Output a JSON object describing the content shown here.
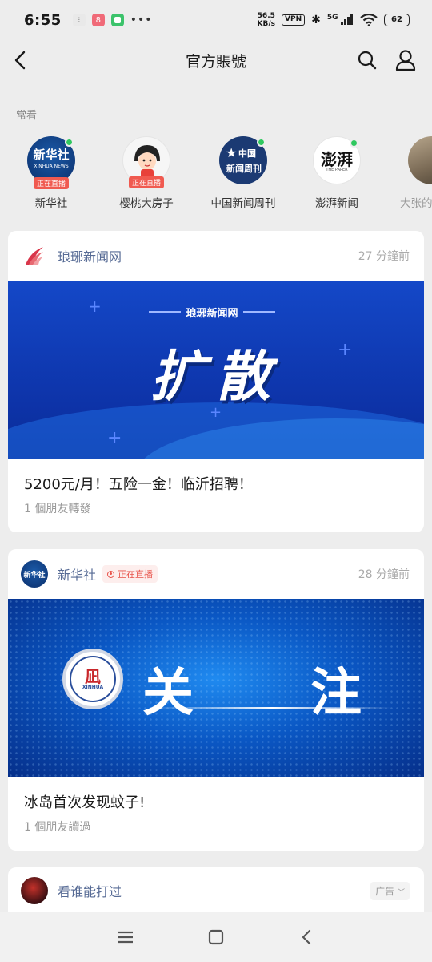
{
  "status": {
    "time": "6:55",
    "net_speed_top": "56.5",
    "net_speed_bottom": "KB/s",
    "vpn": "VPN",
    "signal": "5G",
    "battery": "62"
  },
  "nav": {
    "title": "官方賬號"
  },
  "frequent": {
    "label": "常看",
    "items": [
      {
        "name": "新华社",
        "live": "正在直播",
        "online": true
      },
      {
        "name": "樱桃大房子",
        "live": "正在直播",
        "online": false
      },
      {
        "name": "中国新闻周刊",
        "live": "",
        "online": true
      },
      {
        "name": "澎湃新闻",
        "live": "",
        "online": true
      },
      {
        "name": "大张的",
        "live": "",
        "online": false
      }
    ]
  },
  "cards": [
    {
      "source": "琅琊新闻网",
      "time": "27 分鐘前",
      "banner_brand": "琅琊新闻网",
      "banner_text": "扩散",
      "title": "5200元/月！五险一金！临沂招聘！",
      "sub": "1 個朋友轉發"
    },
    {
      "source": "新华社",
      "live": "正在直播",
      "time": "28 分鐘前",
      "banner_left": "关",
      "banner_right": "注",
      "banner_logo": "XINHUA",
      "title": "冰岛首次发现蚊子!",
      "sub": "1 個朋友讀過"
    },
    {
      "source": "看谁能打过",
      "ad": "广告"
    }
  ],
  "logos": {
    "xinhua_top": "新华社",
    "xinhua_bottom": "XINHUA NEWS",
    "zgxwzk_top": "中国",
    "zgxwzk_bottom": "新闻周刊",
    "pengpai": "澎湃",
    "pengpai_small": "THE PAPER"
  },
  "colors": {
    "link": "#576b95",
    "live": "#f05a50",
    "online": "#2fc85f"
  }
}
